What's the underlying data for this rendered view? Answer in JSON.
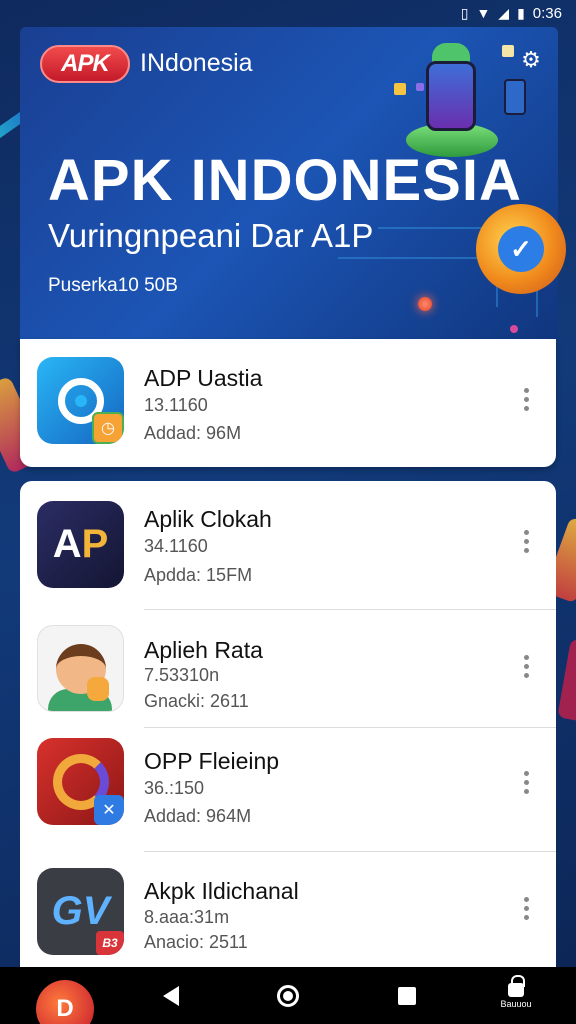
{
  "status_bar": {
    "time": "0:36",
    "icons": [
      "vibrate-icon",
      "wifi-icon",
      "signal-icon",
      "battery-icon"
    ]
  },
  "header": {
    "logo_text": "APK",
    "brand": "INdonesia",
    "title": "APK INDONESIA",
    "subtitle": "Vuringnpeani Dar A1P",
    "caption": "Puserka10 50B"
  },
  "apps": [
    {
      "name": "ADP Uastia",
      "version": "13.1160",
      "meta": "Addad: 96M",
      "icon": "search-app-icon"
    },
    {
      "name": "Aplik Clokah",
      "version": "34.1160",
      "meta": "Apdda: 15FM",
      "icon": "ap-app-icon"
    },
    {
      "name": "Aplieh Rata",
      "version": "7.53310n",
      "meta": "Gnacki: 2611",
      "icon": "avatar-app-icon"
    },
    {
      "name": "OPP Fleieinp",
      "version": "36.:150",
      "meta": "Addad: 964M",
      "icon": "swirl-app-icon"
    },
    {
      "name": "Akpk Ildichanal",
      "version": "8.aaa:31m",
      "meta": "Anacio: 2511",
      "icon": "gv-app-icon"
    }
  ],
  "icon_text": {
    "ap_a": "A",
    "ap_p": "P",
    "gv": "GV",
    "gv_badge": "B3",
    "fab": "D"
  },
  "nav": {
    "lock_label": "Bauuou"
  },
  "colors": {
    "accent": "#1c55b5",
    "logo_red": "#d9252f",
    "background": "#0f2a5e"
  }
}
